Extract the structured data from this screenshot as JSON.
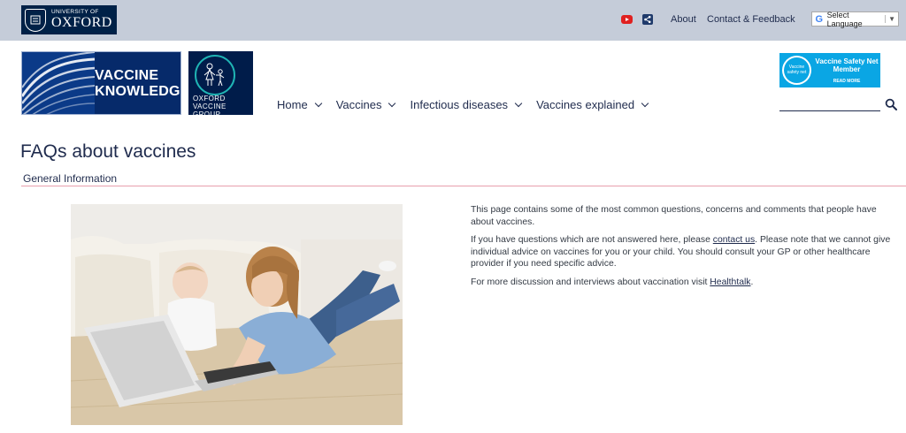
{
  "topbar": {
    "oxford_small": "UNIVERSITY OF",
    "oxford_big": "OXFORD",
    "about": "About",
    "contact": "Contact & Feedback",
    "language": "Select Language",
    "language_arrow": "▼"
  },
  "header": {
    "vk_line1": "VACCINE",
    "vk_line2": "KNOWLEDGE",
    "ovg_line1": "OXFORD",
    "ovg_line2": "VACCINE GROUP",
    "vsn_badge": "Vaccine safety net",
    "vsn_title": "Vaccine Safety Net Member",
    "vsn_more": "READ MORE"
  },
  "nav": [
    {
      "label": "Home"
    },
    {
      "label": "Vaccines"
    },
    {
      "label": "Infectious diseases"
    },
    {
      "label": "Vaccines explained"
    }
  ],
  "search": {
    "placeholder": "",
    "value": ""
  },
  "page": {
    "title": "FAQs about vaccines",
    "section": "General Information"
  },
  "content": {
    "p1": "This page contains some of the most common questions, concerns and comments that people have about vaccines.",
    "p2_before": "If you have questions which are not answered here, please ",
    "p2_link": "contact us",
    "p2_after": ". Please note that we cannot give individual advice on vaccines for you or your child. You should consult your GP or other healthcare provider if you need specific advice.",
    "p3_before": "For more discussion and interviews about vaccination visit ",
    "p3_link": "Healthtalk",
    "p3_after": "."
  },
  "colors": {
    "topbar": "#c5ccd9",
    "oxford_blue": "#002147",
    "vk_blue": "#062a6a",
    "vsn_blue": "#0aa6e4",
    "divider": "#e8a0ad"
  }
}
